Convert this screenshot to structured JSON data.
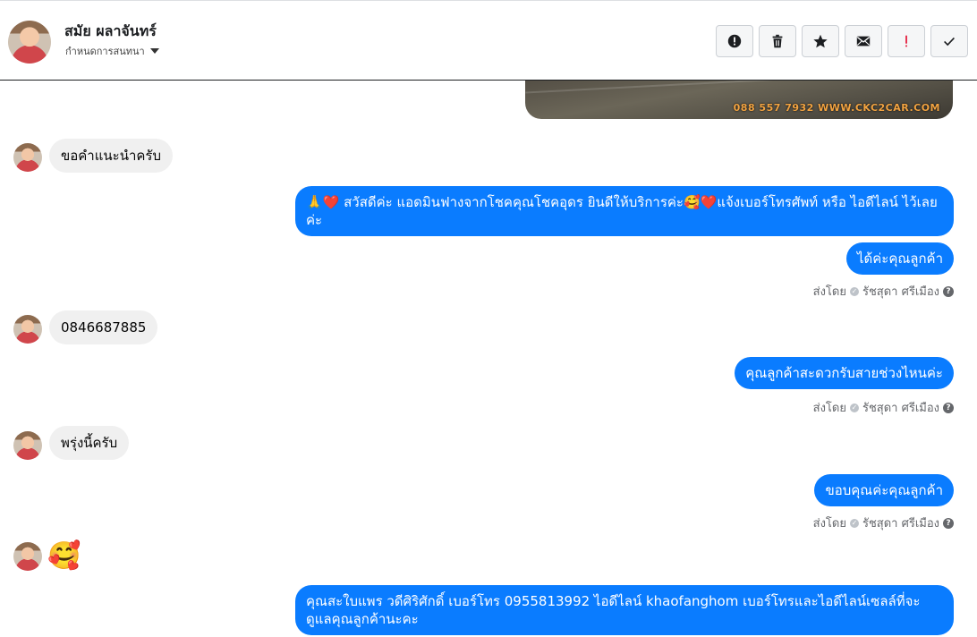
{
  "contact": {
    "name": "สมัย ผลาจันทร์",
    "subtitle": "กำหนดการสนทนา"
  },
  "toolbar": {
    "buttons": [
      {
        "icon": "alert-circle-icon",
        "label": "!"
      },
      {
        "icon": "trash-icon"
      },
      {
        "icon": "star-icon"
      },
      {
        "icon": "mail-icon"
      },
      {
        "icon": "important-icon",
        "label": "!"
      },
      {
        "icon": "check-icon"
      }
    ]
  },
  "attachment": {
    "watermark": "088 557 7932 WWW.CKC2CAR.COM"
  },
  "messages": {
    "m1": "ขอคำแนะนำครับ",
    "m2": "🙏❤️ สวัสดีค่ะ แอดมินฟางจากโชคคุณโชคอุดร ยินดีให้บริการค่ะ🥰❤️แจ้งเบอร์โทรศัพท์ หรือ ไอดีไลน์  ไว้เลยค่ะ",
    "m3": "ได้ค่ะคุณลูกค้า",
    "m4": "0846687885",
    "m5": "คุณลูกค้าสะดวกรับสายช่วงไหนค่ะ",
    "m6": "พรุ่งนี้ครับ",
    "m7": "ขอบคุณค่ะคุณลูกค้า",
    "m8": "🥰",
    "m9": "คุณสะใบแพร วดีศิริศักดิ์ เบอร์โทร 0955813992  ไอดีไลน์  khaofanghom   เบอร์โทรและไอดีไลน์เซลล์ที่จะดูแลคุณลูกค้านะคะ"
  },
  "sent_by": {
    "prefix": "ส่งโดย",
    "agent": "รัชสุดา ศรีเมือง",
    "help": "?"
  },
  "colors": {
    "outgoing": "#0a7cff",
    "incoming": "#f0f0f0"
  }
}
